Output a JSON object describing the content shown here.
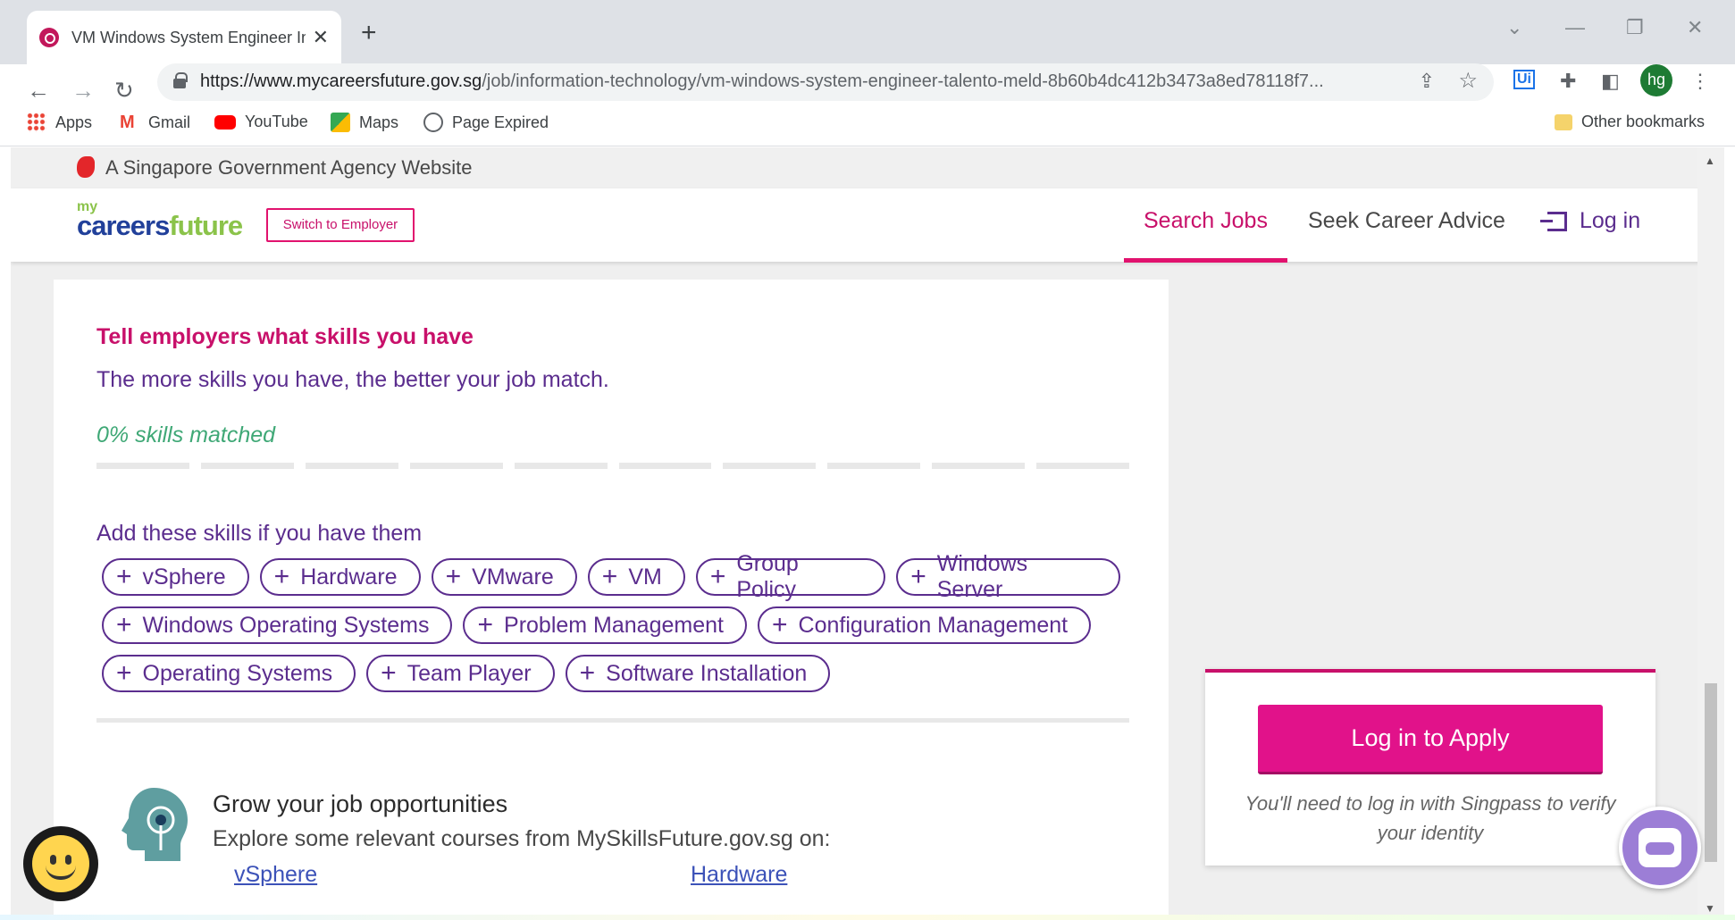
{
  "browser": {
    "tab_title": "VM Windows System Engineer In",
    "url_host": "https://www.mycareersfuture.gov.sg",
    "url_path": "/job/information-technology/vm-windows-system-engineer-talento-meld-8b60b4dc412b3473a8ed78118f7...",
    "avatar_initials": "hg",
    "bookmarks": [
      "Apps",
      "Gmail",
      "YouTube",
      "Maps",
      "Page Expired"
    ],
    "other_bookmarks": "Other bookmarks"
  },
  "gov_banner": "A Singapore Government Agency Website",
  "header": {
    "logo_my": "my",
    "logo_careers": "careers",
    "logo_future": "future",
    "switch_label": "Switch to Employer",
    "nav_search": "Search Jobs",
    "nav_advice": "Seek Career Advice",
    "nav_login": "Log in"
  },
  "skills": {
    "heading": "Tell employers what skills you have",
    "subheading": "The more skills you have, the better your job match.",
    "matched": "0% skills matched",
    "matched_fraction": 0,
    "add_label": "Add these skills if you have them",
    "chips_row1": [
      "vSphere",
      "Hardware",
      "VMware",
      "VM",
      "Group Policy",
      "Windows Server"
    ],
    "chips_row2": [
      "Windows Operating Systems",
      "Problem Management",
      "Configuration Management"
    ],
    "chips_row3": [
      "Operating Systems",
      "Team Player",
      "Software Installation"
    ]
  },
  "grow": {
    "title": "Grow your job opportunities",
    "subtitle": "Explore some relevant courses from MySkillsFuture.gov.sg on:",
    "courses": [
      "vSphere",
      "Hardware"
    ]
  },
  "apply": {
    "button": "Log in to Apply",
    "note": "You'll need to log in with Singpass to verify your identity"
  },
  "colors": {
    "accent": "#e1128a",
    "purple": "#5b2d8e",
    "green": "#3fa876"
  }
}
